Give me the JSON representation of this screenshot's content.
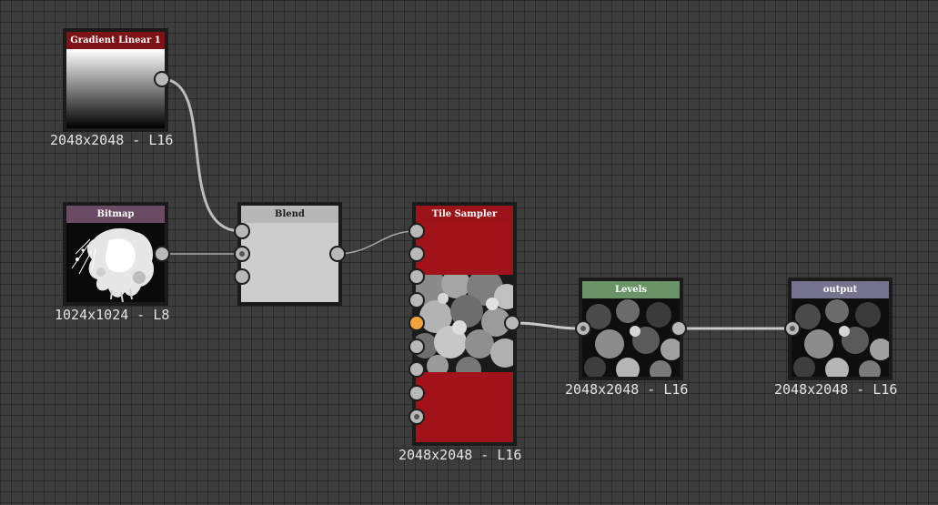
{
  "graph": {
    "nodes": {
      "gradient": {
        "title": "Gradient Linear 1",
        "resolution": "2048x2048 - L16",
        "header_color": "#7d1217"
      },
      "bitmap": {
        "title": "Bitmap",
        "resolution": "1024x1024 - L8",
        "header_color": "#6b4a63"
      },
      "blend": {
        "title": "Blend",
        "header_color": "#b7b7b7"
      },
      "tile_sampler": {
        "title": "Tile Sampler",
        "resolution": "2048x2048 - L16",
        "header_color": "#9b1318"
      },
      "levels": {
        "title": "Levels",
        "resolution": "2048x2048 - L16",
        "header_color": "#6a9467"
      },
      "output": {
        "title": "output",
        "resolution": "2048x2048 - L16",
        "header_color": "#75738d"
      }
    },
    "colors": {
      "background": "#3c3c3c",
      "grid_line": "#2e2e2e",
      "wire": "#c9c9c9",
      "port": "#b8b8b8",
      "port_active": "#f2a33a",
      "tile_sampler_fill": "#a01419"
    }
  }
}
